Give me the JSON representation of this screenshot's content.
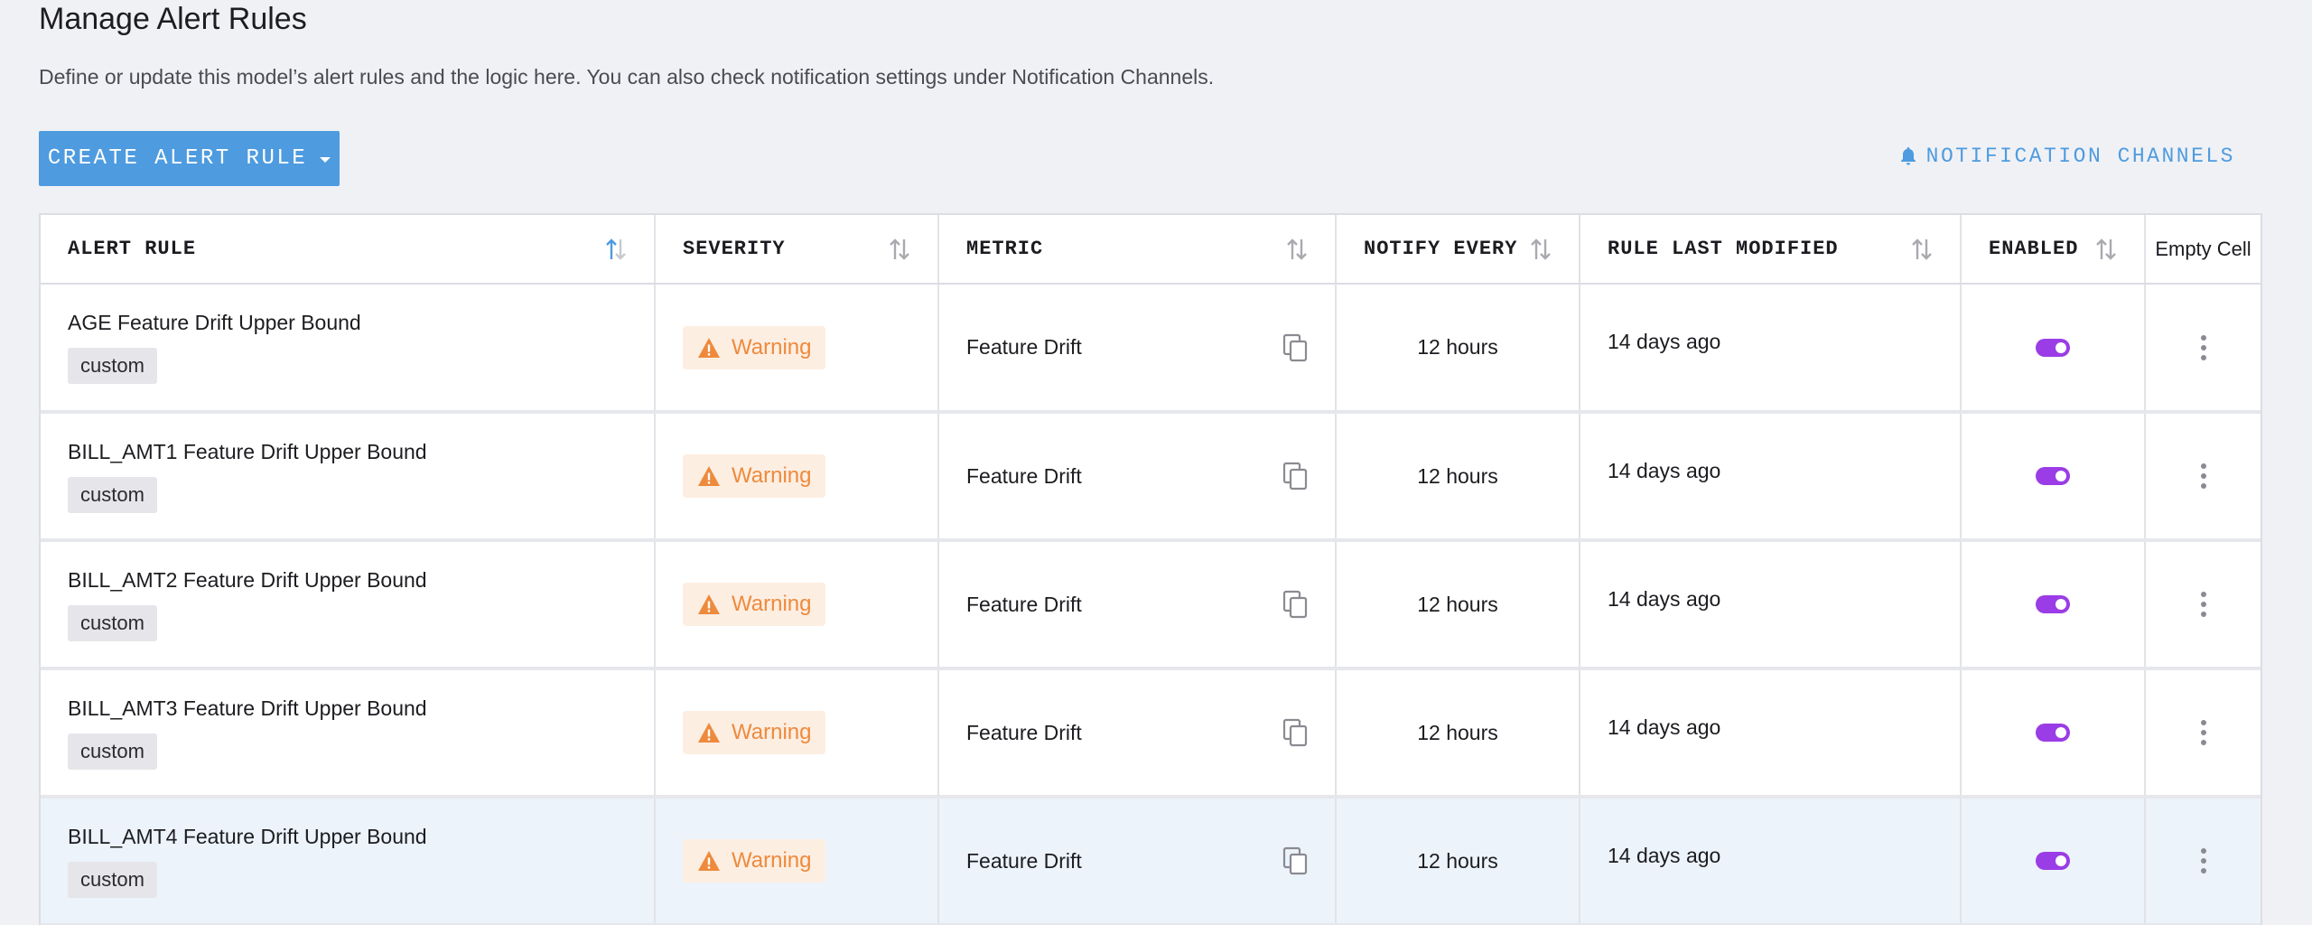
{
  "page": {
    "title": "Manage Alert Rules",
    "description": "Define or update this model’s alert rules and the logic here. You can also check notification settings under Notification Channels."
  },
  "toolbar": {
    "create_label": "CREATE ALERT RULE",
    "notification_label": "NOTIFICATION CHANNELS"
  },
  "colors": {
    "accent": "#4e9bdf",
    "warning": "#ee8a3c",
    "toggle_on": "#9b3de6"
  },
  "table": {
    "headers": {
      "alert_rule": "ALERT RULE",
      "severity": "SEVERITY",
      "metric": "METRIC",
      "notify_every": "NOTIFY EVERY",
      "rule_last_modified": "RULE LAST MODIFIED",
      "enabled": "ENABLED",
      "empty_cell": "Empty Cell"
    },
    "rows": [
      {
        "name": "AGE Feature Drift Upper Bound",
        "tag": "custom",
        "severity": "Warning",
        "metric": "Feature Drift",
        "notify_every": "12 hours",
        "modified": "14 days ago",
        "enabled": true
      },
      {
        "name": "BILL_AMT1 Feature Drift Upper Bound",
        "tag": "custom",
        "severity": "Warning",
        "metric": "Feature Drift",
        "notify_every": "12 hours",
        "modified": "14 days ago",
        "enabled": true
      },
      {
        "name": "BILL_AMT2 Feature Drift Upper Bound",
        "tag": "custom",
        "severity": "Warning",
        "metric": "Feature Drift",
        "notify_every": "12 hours",
        "modified": "14 days ago",
        "enabled": true
      },
      {
        "name": "BILL_AMT3 Feature Drift Upper Bound",
        "tag": "custom",
        "severity": "Warning",
        "metric": "Feature Drift",
        "notify_every": "12 hours",
        "modified": "14 days ago",
        "enabled": true
      },
      {
        "name": "BILL_AMT4 Feature Drift Upper Bound",
        "tag": "custom",
        "severity": "Warning",
        "metric": "Feature Drift",
        "notify_every": "12 hours",
        "modified": "14 days ago",
        "enabled": true
      }
    ]
  }
}
